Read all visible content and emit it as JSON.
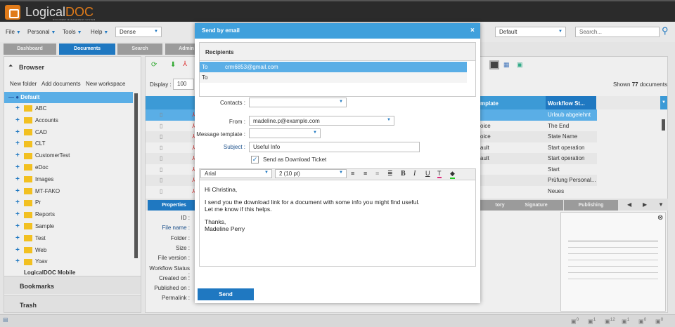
{
  "app": {
    "logo_main": "Logical",
    "logo_accent": "DOC",
    "logo_sub": "DOCUMENT MANAGEMENT SYSTEM"
  },
  "menu": {
    "items": [
      "File",
      "Personal",
      "Tools",
      "Help"
    ],
    "density": "Dense",
    "template_select": "Default",
    "search_placeholder": "Search..."
  },
  "tabs": [
    "Dashboard",
    "Documents",
    "Search",
    "Admin"
  ],
  "browser": {
    "title": "Browser",
    "actions": [
      "New folder",
      "Add documents",
      "New workspace"
    ],
    "root": "Default",
    "folders": [
      "ABC",
      "Accounts",
      "CAD",
      "CLT",
      "CustomerTest",
      "eDoc",
      "Images",
      "MT-FAKO",
      "Pr",
      "Reports",
      "Sample",
      "Test",
      "Web",
      "Yoav"
    ],
    "next_root": "LogicalDOC Mobile",
    "bookmarks": "Bookmarks",
    "trash": "Trash"
  },
  "docs": {
    "display_label": "Display :",
    "display_value": "100",
    "shown_prefix": "Shown ",
    "shown_count": "77",
    "shown_suffix": " documents",
    "col_template": "mplate",
    "col_workflow": "Workflow St...",
    "rows": [
      {
        "t": "",
        "w": "Urlaub abgelehnt"
      },
      {
        "t": "oice",
        "w": "The End"
      },
      {
        "t": "oice",
        "w": "State Name"
      },
      {
        "t": "ault",
        "w": "Start operation"
      },
      {
        "t": "ault",
        "w": "Start operation"
      },
      {
        "t": "",
        "w": "Start"
      },
      {
        "t": "",
        "w": "Prüfung Personal..."
      },
      {
        "t": "",
        "w": "Neues Rundschre..."
      }
    ]
  },
  "detail_tabs": [
    "Properties",
    "tory",
    "Signature",
    "Publishing"
  ],
  "props": [
    "ID :",
    "File name :",
    "Folder :",
    "Size :",
    "File version :",
    "Workflow Status :",
    "Created on :",
    "Published on :",
    "Permalink :"
  ],
  "status_counts": [
    "0",
    "1",
    "12",
    "1",
    "0",
    "0"
  ],
  "dialog": {
    "title": "Send by email",
    "recipients_header": "Recipients",
    "recipients": [
      {
        "type": "To",
        "email": "crm6853@gmail.com"
      },
      {
        "type": "To",
        "email": ""
      }
    ],
    "contacts_label": "Contacts :",
    "from_label": "From :",
    "from_value": "madeline.p@example.com",
    "template_label": "Message template :",
    "subject_label": "Subject :",
    "subject_value": "Useful Info",
    "ticket_label": "Send as Download Ticket",
    "ticket_checked": true,
    "font": "Arial",
    "size": "2 (10 pt)",
    "body": [
      "Hi Christina,",
      "I send you the download link for a document with some info you might find useful.",
      "Let me know if this helps.",
      "Thanks,",
      "Madeline Perry"
    ],
    "send": "Send"
  }
}
